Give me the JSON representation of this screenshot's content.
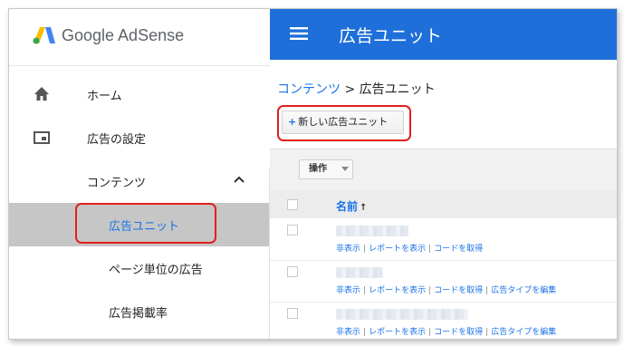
{
  "sidebar": {
    "logo_text": "Google AdSense",
    "items": [
      {
        "label": "ホーム",
        "icon": "home-icon"
      },
      {
        "label": "広告の設定",
        "icon": "ad-settings-icon"
      },
      {
        "label": "コンテンツ",
        "icon": "chevron-up-icon",
        "expanded": true
      },
      {
        "label": "広告ユニット",
        "selected": true
      },
      {
        "label": "ページ単位の広告"
      },
      {
        "label": "広告掲載率"
      }
    ]
  },
  "header": {
    "title": "広告ユニット",
    "color": "#1e6fd9"
  },
  "breadcrumb": {
    "parent": "コンテンツ",
    "separator": " > ",
    "current": "広告ユニット"
  },
  "toolbar": {
    "new_button_plus": "+",
    "new_button_label": "新しい広告ユニット",
    "operations_label": "操作"
  },
  "table": {
    "column_name": "名前",
    "sort_indicator": "↑",
    "rows": [
      {
        "actions": [
          "非表示",
          "レポートを表示",
          "コードを取得"
        ]
      },
      {
        "actions": [
          "非表示",
          "レポートを表示",
          "コードを取得",
          "広告タイプを編集"
        ]
      },
      {
        "actions": [
          "非表示",
          "レポートを表示",
          "コードを取得",
          "広告タイプを編集"
        ]
      }
    ]
  },
  "colors": {
    "accent": "#1a73e8",
    "highlight_box": "#e0201a",
    "selected_bg": "#c6c6c6"
  }
}
